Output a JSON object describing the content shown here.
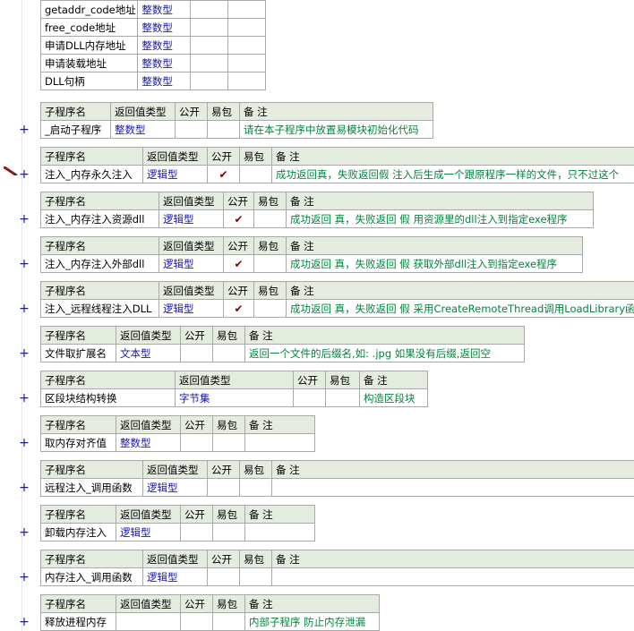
{
  "headers": {
    "name": "子程序名",
    "ret": "返回值类型",
    "public": "公开",
    "easy": "易包",
    "note": "备 注"
  },
  "check_symbol": "✔",
  "plus_symbol": "+",
  "vars": [
    {
      "name": "getaddr_code地址",
      "type": "整数型"
    },
    {
      "name": "free_code地址",
      "type": "整数型"
    },
    {
      "name": "申请DLL内存地址",
      "type": "整数型"
    },
    {
      "name": "申请装载地址",
      "type": "整数型"
    },
    {
      "name": "DLL句柄",
      "type": "整数型"
    }
  ],
  "subs": [
    {
      "name": "_启动子程序",
      "type": "整数型",
      "public": "",
      "easy": "",
      "note": "请在本子程序中放置易模块初始化代码"
    },
    {
      "name": "注入_内存永久注入",
      "type": "逻辑型",
      "public": "✔",
      "easy": "",
      "note": "成功返回真，失败返回假 注入后生成一个跟原程序一样的文件，只不过这个"
    },
    {
      "name": "注入_内存注入资源dll",
      "type": "逻辑型",
      "public": "✔",
      "easy": "",
      "note": "成功返回 真，失败返回 假 用资源里的dll注入到指定exe程序"
    },
    {
      "name": "注入_内存注入外部dll",
      "type": "逻辑型",
      "public": "✔",
      "easy": "",
      "note": "成功返回 真，失败返回 假 获取外部dll注入到指定exe程序"
    },
    {
      "name": "注入_远程线程注入DLL",
      "type": "逻辑型",
      "public": "✔",
      "easy": "",
      "note": "成功返回 真，失败返回 假 采用CreateRemoteThread调用LoadLibrary函"
    },
    {
      "name": "文件取扩展名",
      "type": "文本型",
      "public": "",
      "easy": "",
      "note": "返回一个文件的后缀名,如: .jpg  如果没有后缀,返回空"
    },
    {
      "name": "区段块结构转换",
      "type": "字节集",
      "public": "",
      "easy": "",
      "note": "构造区段块"
    },
    {
      "name": "取内存对齐值",
      "type": "整数型",
      "public": "",
      "easy": "",
      "note": ""
    },
    {
      "name": "远程注入_调用函数",
      "type": "逻辑型",
      "public": "",
      "easy": "",
      "note": ""
    },
    {
      "name": "卸载内存注入",
      "type": "逻辑型",
      "public": "",
      "easy": "",
      "note": ""
    },
    {
      "name": "内存注入_调用函数",
      "type": "逻辑型",
      "public": "",
      "easy": "",
      "note": ""
    },
    {
      "name": "释放进程内存",
      "type": "",
      "public": "",
      "easy": "",
      "note": "内部子程序 防止内存泄漏"
    }
  ]
}
